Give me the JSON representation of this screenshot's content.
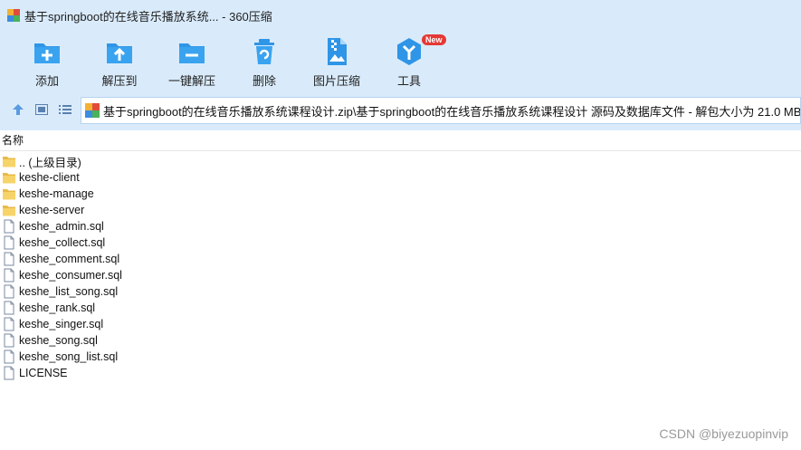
{
  "window": {
    "title": "基于springboot的在线音乐播放系统... - 360压缩"
  },
  "toolbar": {
    "tools": [
      {
        "label": "添加",
        "icon": "add-folder-icon"
      },
      {
        "label": "解压到",
        "icon": "extract-to-icon"
      },
      {
        "label": "一键解压",
        "icon": "one-click-extract-icon"
      },
      {
        "label": "删除",
        "icon": "delete-icon"
      },
      {
        "label": "图片压缩",
        "icon": "image-compress-icon"
      },
      {
        "label": "工具",
        "icon": "tools-icon",
        "badge": "New"
      }
    ]
  },
  "addressbar": {
    "path": "基于springboot的在线音乐播放系统课程设计.zip\\基于springboot的在线音乐播放系统课程设计 源码及数据库文件 - 解包大小为 21.0 MB"
  },
  "file_list": {
    "column_header": "名称",
    "items": [
      {
        "name": ".. (上级目录)",
        "type": "folder"
      },
      {
        "name": "keshe-client",
        "type": "folder"
      },
      {
        "name": "keshe-manage",
        "type": "folder"
      },
      {
        "name": "keshe-server",
        "type": "folder"
      },
      {
        "name": "keshe_admin.sql",
        "type": "file"
      },
      {
        "name": "keshe_collect.sql",
        "type": "file"
      },
      {
        "name": "keshe_comment.sql",
        "type": "file"
      },
      {
        "name": "keshe_consumer.sql",
        "type": "file"
      },
      {
        "name": "keshe_list_song.sql",
        "type": "file"
      },
      {
        "name": "keshe_rank.sql",
        "type": "file"
      },
      {
        "name": "keshe_singer.sql",
        "type": "file"
      },
      {
        "name": "keshe_song.sql",
        "type": "file"
      },
      {
        "name": "keshe_song_list.sql",
        "type": "file"
      },
      {
        "name": "LICENSE",
        "type": "file"
      }
    ]
  },
  "watermark": "CSDN @biyezuopinvip",
  "colors": {
    "chrome_bg": "#d9ebfb",
    "icon_blue": "#2f95e6",
    "folder_yellow": "#f7d46a",
    "badge_red": "#e53935"
  }
}
